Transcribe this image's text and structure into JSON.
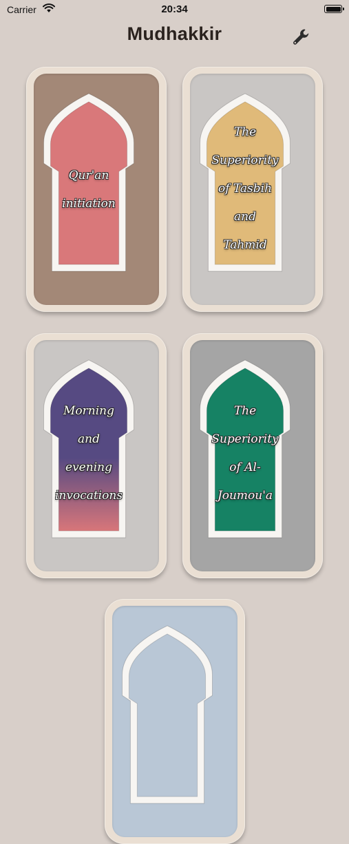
{
  "status_bar": {
    "carrier": "Carrier",
    "time": "20:34"
  },
  "nav": {
    "title": "Mudhakkir",
    "settings_icon": "wrench-icon"
  },
  "cards": [
    {
      "label_lines": [
        "Qur'an",
        "initiation"
      ],
      "bg": "#a38877",
      "arch_fill": "#d9787a"
    },
    {
      "label_lines": [
        "The",
        "Superiority",
        "of Tasbih",
        "and",
        "Tahmid"
      ],
      "bg": "#c9c6c4",
      "arch_fill": "#e0ba79"
    },
    {
      "label_lines": [
        "Morning",
        "and",
        "evening",
        "invocations"
      ],
      "bg": "#c9c6c4",
      "arch_fill": "#564a82",
      "arch_fill_bottom": "#d8767a"
    },
    {
      "label_lines": [
        "The",
        "Superiority",
        "of Al-",
        "Joumou'a"
      ],
      "bg": "#a5a5a5",
      "arch_fill": "#168264"
    },
    {
      "label_lines": [],
      "bg": "#b9c7d6",
      "arch_fill": "#b9c7d6"
    }
  ]
}
